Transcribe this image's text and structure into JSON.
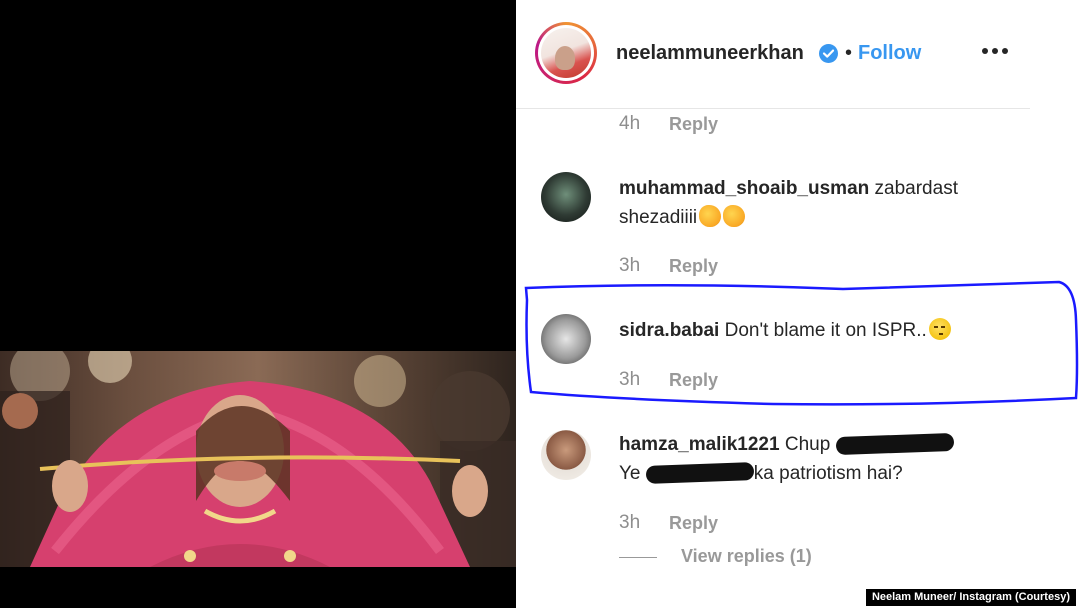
{
  "post": {
    "username": "neelammuneerkhan",
    "separator": "•",
    "follow_label": "Follow"
  },
  "comments": [
    {
      "text": "",
      "time": "4h",
      "reply_label": "Reply"
    },
    {
      "username": "muhammad_shoaib_usman",
      "text": "zabardast shezadiiii",
      "emoji": [
        "clapping-hands",
        "clapping-hands"
      ],
      "time": "3h",
      "reply_label": "Reply"
    },
    {
      "username": "sidra.babai",
      "text": "Don't blame it on ISPR..",
      "emoji": [
        "smirking-face"
      ],
      "time": "3h",
      "reply_label": "Reply"
    },
    {
      "username": "hamza_malik1221",
      "text_line1": "Chup",
      "text_line2_prefix": "Ye",
      "text_line2_suffix": "ka patriotism hai?",
      "time": "3h",
      "reply_label": "Reply",
      "view_replies": "View replies (1)"
    }
  ],
  "highlight_color": "#1a1aff",
  "accent_color": "#3897f0",
  "credit": "Neelam Muneer/ Instagram (Courtesy)"
}
